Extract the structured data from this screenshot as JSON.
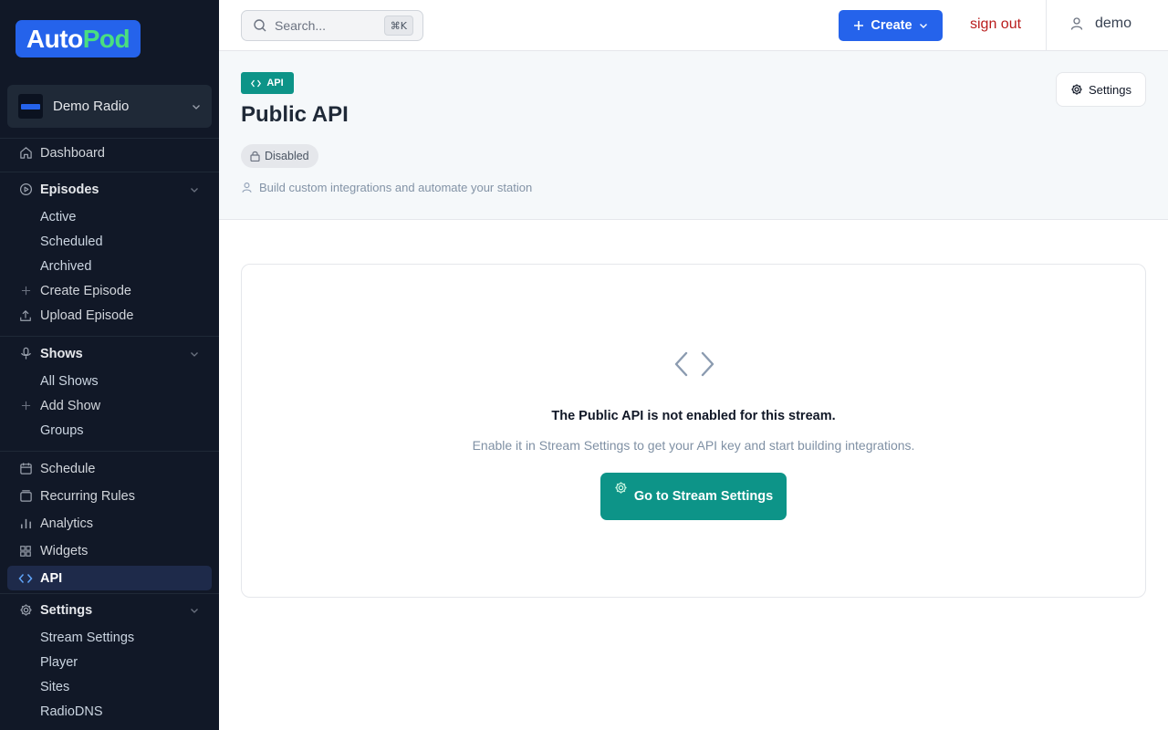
{
  "brand": {
    "part1": "Auto",
    "part2": "Pod"
  },
  "station": {
    "name": "Demo Radio"
  },
  "sidebar": {
    "dashboard": "Dashboard",
    "episodes": {
      "label": "Episodes",
      "items": [
        "Active",
        "Scheduled",
        "Archived",
        "Create Episode",
        "Upload Episode"
      ]
    },
    "shows": {
      "label": "Shows",
      "items": [
        "All Shows",
        "Add Show",
        "Groups"
      ]
    },
    "schedule": "Schedule",
    "recurring": "Recurring Rules",
    "analytics": "Analytics",
    "widgets": "Widgets",
    "api": "API",
    "settings": {
      "label": "Settings",
      "items": [
        "Stream Settings",
        "Player",
        "Sites",
        "RadioDNS"
      ]
    }
  },
  "topbar": {
    "search_placeholder": "Search...",
    "search_shortcut": "⌘K",
    "create_label": "Create",
    "signout_label": "sign out",
    "username": "demo"
  },
  "header": {
    "badge": "API",
    "title": "Public API",
    "status": "Disabled",
    "subtitle": "Build custom integrations and automate your station",
    "settings_label": "Settings"
  },
  "card": {
    "title": "The Public API is not enabled for this stream.",
    "subtitle": "Enable it in Stream Settings to get your API key and start building integrations.",
    "button_label": "Go to Stream Settings"
  },
  "colors": {
    "sidebar_bg": "#111827",
    "primary": "#2563eb",
    "teal": "#0d9488",
    "danger": "#b91c1c"
  }
}
